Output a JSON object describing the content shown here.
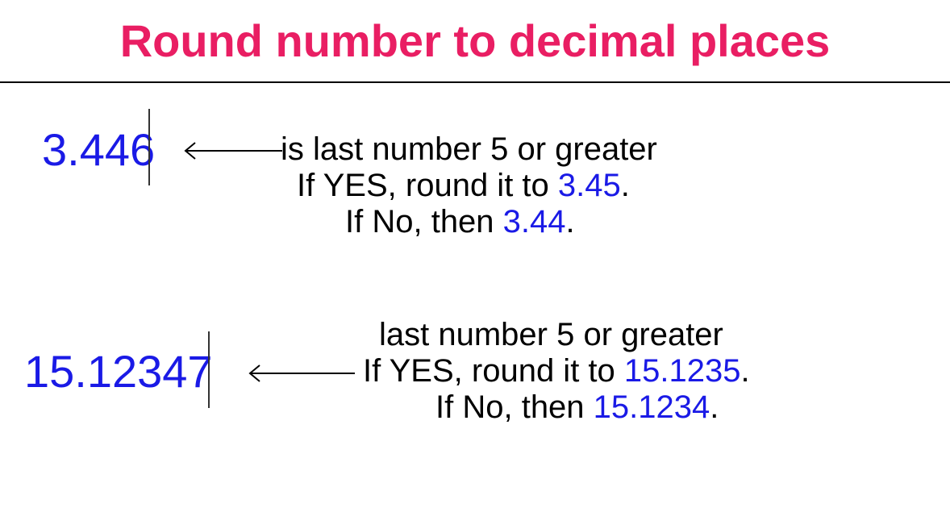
{
  "title": "Round number to decimal places",
  "example1": {
    "number": "3.446",
    "line1_text": "is last number 5 or greater",
    "line2_prefix": "If YES, round it to ",
    "line2_value": "3.45",
    "line2_suffix": ".",
    "line3_prefix": "If No, then ",
    "line3_value": "3.44",
    "line3_suffix": "."
  },
  "example2": {
    "number": "15.12347",
    "line1_text": "last number 5 or greater",
    "line2_prefix": "If YES, round it to ",
    "line2_value": "15.1235",
    "line2_suffix": ".",
    "line3_prefix": "If No, then ",
    "line3_value": "15.1234",
    "line3_suffix": "."
  }
}
